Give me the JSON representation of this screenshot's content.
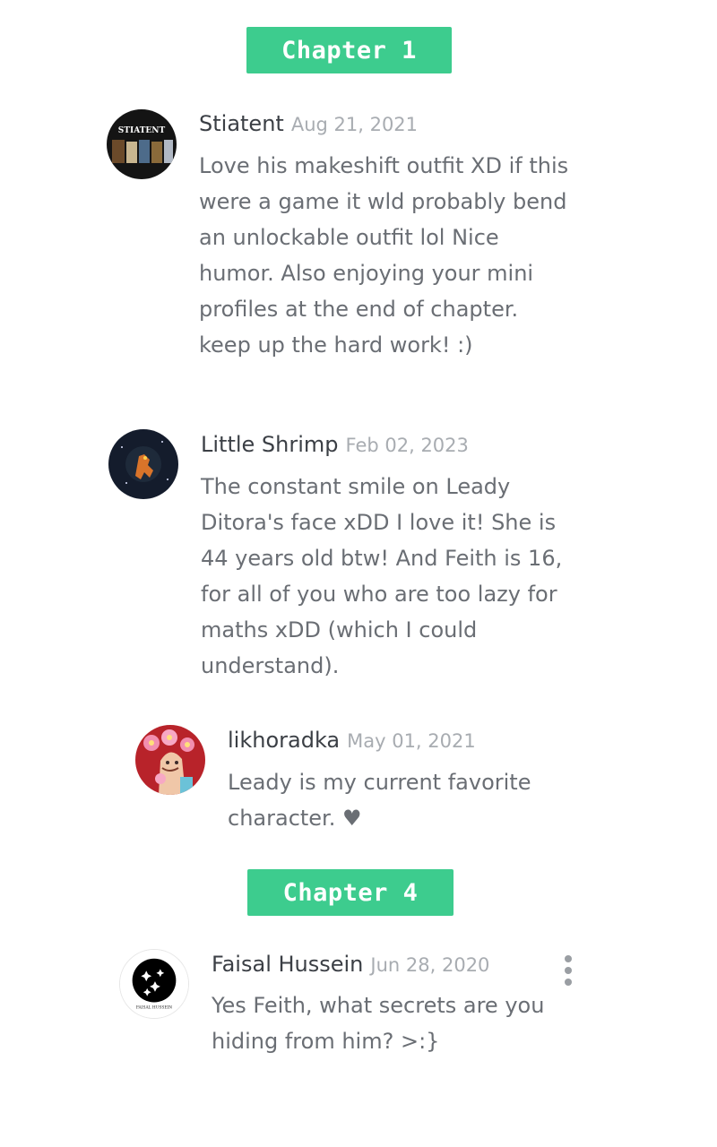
{
  "chapters": [
    {
      "label": "Chapter 1"
    },
    {
      "label": "Chapter 4"
    }
  ],
  "comments": [
    {
      "author": "Stiatent",
      "date": "Aug 21, 2021",
      "text": "Love his makeshift outfit XD if this were a game it wld probably bend an unlockable outfit lol Nice humor. Also enjoying your mini profiles at the end of chapter. keep up the hard work! :)",
      "avatar_text": "STIATENT",
      "avatar_icon": "stiatent-avatar-image"
    },
    {
      "author": "Little Shrimp",
      "date": "Feb 02, 2023",
      "text": "The constant smile on Leady Ditora's face xDD I love it! She is 44 years old btw! And Feith is 16, for all of you who are too lazy for maths xDD (which I could understand).",
      "avatar_icon": "shrimp-creature-avatar-image"
    },
    {
      "author": "likhoradka",
      "date": "May 01, 2021",
      "text": "Leady is my current favorite character. ♥",
      "avatar_icon": "flower-girl-avatar-image"
    },
    {
      "author": "Faisal Hussein",
      "date": "Jun 28, 2020",
      "text": "Yes Feith, what secrets are you hiding from him? >:}",
      "avatar_text": "FAISAL HUSSEIN",
      "avatar_icon": "sparkle-logo-avatar-image",
      "menu_icon": "more-vertical-icon"
    }
  ],
  "colors": {
    "chapter_bg": "#3dcc8e",
    "author": "#3b3f45",
    "date": "#a8acb1",
    "body": "#6a6e74"
  }
}
